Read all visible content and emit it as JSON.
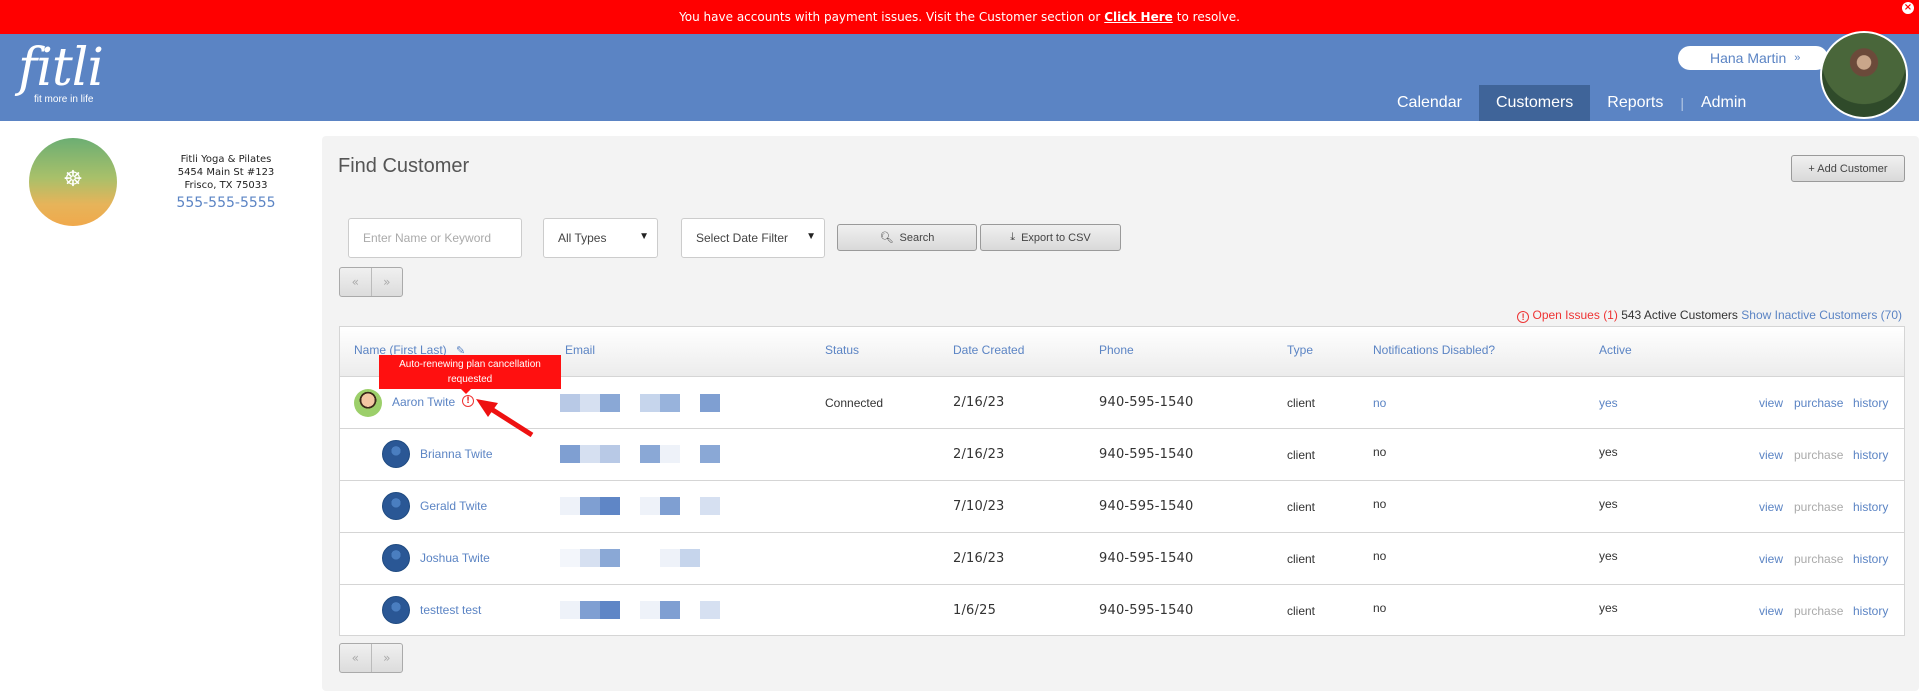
{
  "alert": {
    "text_before": "You have accounts with payment issues. Visit the Customer section or",
    "link": "Click Here",
    "text_after": "to resolve.",
    "close_icon": "close-icon",
    "color": "#ff0000"
  },
  "header": {
    "logo": "fitli",
    "tagline": "fit more in life",
    "user_name": "Hana Martin",
    "user_chevron": "»",
    "nav": [
      "Calendar",
      "Customers",
      "Reports",
      "Admin"
    ],
    "nav_active": "Customers",
    "brand_color": "#5b84c4"
  },
  "studio": {
    "name": "Fitli Yoga & Pilates",
    "address1": "5454 Main St #123",
    "address2": "Frisco, TX 75033",
    "phone": "555-555-5555",
    "logo_text": "FITLI YOGA & PILATES"
  },
  "find": {
    "title": "Find Customer",
    "add_button": "+ Add Customer",
    "search_placeholder": "Enter Name or Keyword",
    "type_select": "All Types",
    "date_select": "Select Date Filter",
    "search_button": "Search",
    "export_button": "Export to CSV",
    "pager_prev": "«",
    "pager_next": "»"
  },
  "summary": {
    "open_issues": "Open Issues (1)",
    "active": "543 Active Customers",
    "inactive": "Show Inactive Customers (70)"
  },
  "table": {
    "headers": [
      "Name (First Last)",
      "Email",
      "Status",
      "Date Created",
      "Phone",
      "Type",
      "Notifications Disabled?",
      "Active"
    ],
    "tooltip": "Auto-renewing plan cancellation requested",
    "rows": [
      {
        "name": "Aaron Twite",
        "status": "Connected",
        "date": "2/16/23",
        "phone": "940-595-1540",
        "type": "client",
        "notif": "no",
        "active": "yes",
        "actions": [
          "view",
          "purchase",
          "history"
        ]
      },
      {
        "name": "Brianna Twite",
        "status": "",
        "date": "2/16/23",
        "phone": "940-595-1540",
        "type": "client",
        "notif": "no",
        "active": "yes",
        "actions": [
          "view",
          "purchase",
          "history"
        ]
      },
      {
        "name": "Gerald Twite",
        "status": "",
        "date": "7/10/23",
        "phone": "940-595-1540",
        "type": "client",
        "notif": "no",
        "active": "yes",
        "actions": [
          "view",
          "purchase",
          "history"
        ]
      },
      {
        "name": "Joshua Twite",
        "status": "",
        "date": "2/16/23",
        "phone": "940-595-1540",
        "type": "client",
        "notif": "no",
        "active": "yes",
        "actions": [
          "view",
          "purchase",
          "history"
        ]
      },
      {
        "name": "testtest test",
        "status": "",
        "date": "1/6/25",
        "phone": "940-595-1540",
        "type": "client",
        "notif": "no",
        "active": "yes",
        "actions": [
          "view",
          "purchase",
          "history"
        ]
      }
    ]
  }
}
